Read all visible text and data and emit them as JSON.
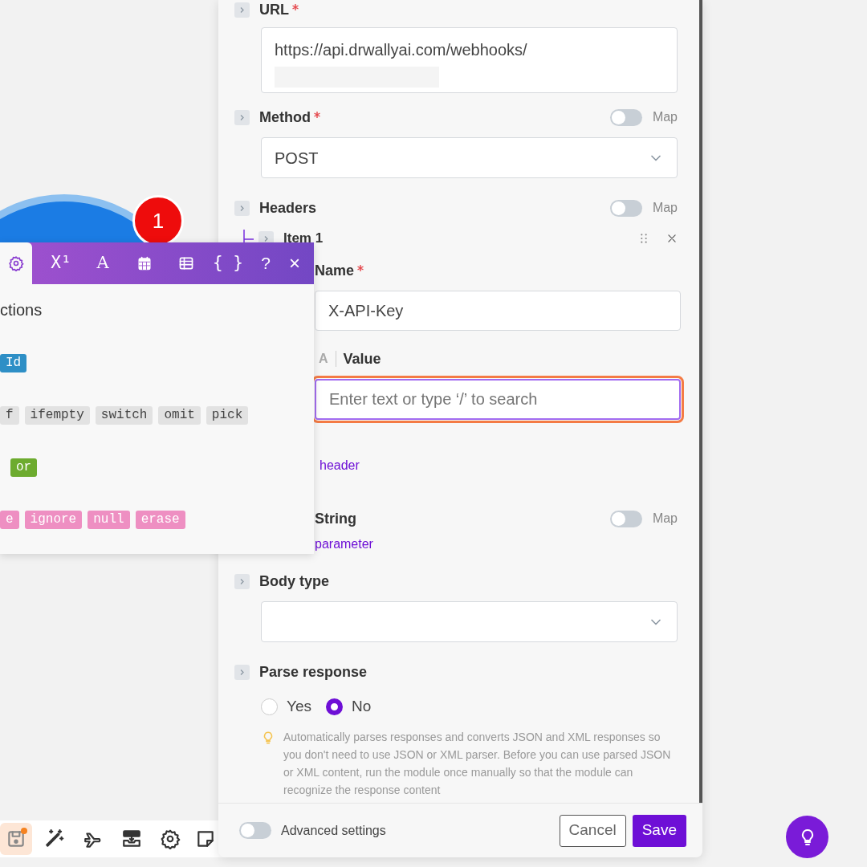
{
  "canvas": {
    "module": {
      "badge": "1"
    },
    "toolbar": [
      {
        "kind": "save",
        "selected": true,
        "badge": true
      },
      {
        "kind": "wand",
        "selected": false,
        "badge": false
      },
      {
        "kind": "plane",
        "selected": false,
        "badge": false
      },
      {
        "kind": "tray",
        "selected": false,
        "badge": false
      },
      {
        "kind": "gear",
        "selected": false,
        "badge": false
      },
      {
        "kind": "note",
        "selected": false,
        "badge": false
      }
    ]
  },
  "panel": {
    "fields": [
      {
        "kind": "textarea",
        "label": "URL",
        "required": true,
        "value": "https://api.drwallyai.com/webhooks/",
        "redacted": true
      },
      {
        "kind": "select",
        "label": "Method",
        "required": true,
        "map": {
          "on": false,
          "label": "Map"
        },
        "value": "POST"
      },
      {
        "kind": "array",
        "label": "Headers",
        "required": false,
        "map": {
          "on": false,
          "label": "Map"
        },
        "items": [
          {
            "title": "Item 1",
            "fields": [
              {
                "kind": "text",
                "label": "Name",
                "required": true,
                "value": "X-API-Key"
              },
              {
                "kind": "text",
                "label": "Value",
                "required": false,
                "mode_label": "A",
                "placeholder": "Enter text or type ‘/’ to search",
                "focused": true
              }
            ]
          }
        ],
        "add_link": "header"
      },
      {
        "kind": "array",
        "label": "String",
        "required": false,
        "map": {
          "on": false,
          "label": "Map"
        },
        "add_link": "parameter"
      },
      {
        "kind": "select",
        "label": "Body type",
        "required": false
      },
      {
        "kind": "radio",
        "label": "Parse response",
        "required": false,
        "options": [
          {
            "label": "Yes",
            "selected": false
          },
          {
            "label": "No",
            "selected": true
          }
        ],
        "hint": "Automatically parses responses and converts JSON and XML responses so you don't need to use JSON or XML parser. Before you can use parsed JSON or XML content, run the module once manually so that the module can recognize the response content"
      }
    ],
    "footer": {
      "advanced_settings": {
        "label": "Advanced settings",
        "on": false
      },
      "buttons": [
        {
          "label": "Cancel",
          "kind": "secondary"
        },
        {
          "label": "Save",
          "kind": "primary"
        }
      ]
    }
  },
  "functions_popup": {
    "tabs": [
      {
        "kind": "gear",
        "selected": true
      },
      {
        "kind": "text",
        "label": "X¹",
        "selected": false
      },
      {
        "kind": "text",
        "label": "A",
        "selected": false
      },
      {
        "kind": "calendar",
        "selected": false
      },
      {
        "kind": "table",
        "selected": false
      },
      {
        "kind": "text",
        "label": "{ }",
        "selected": false
      }
    ],
    "help": "?",
    "close": "×",
    "title": "ctions",
    "groups": [
      {
        "color": "#2e8fc6",
        "items": [
          "Id"
        ]
      },
      {
        "color": "#e2e2e2",
        "items": [
          "f",
          "ifempty",
          "switch",
          "omit",
          "pick"
        ]
      },
      {
        "color": "#6dab2f",
        "items": [
          "or"
        ]
      },
      {
        "color": "#ee8fc2",
        "items": [
          "e",
          "ignore",
          "null",
          "erase"
        ]
      }
    ]
  },
  "help_button": {
    "kind": "bulb"
  }
}
